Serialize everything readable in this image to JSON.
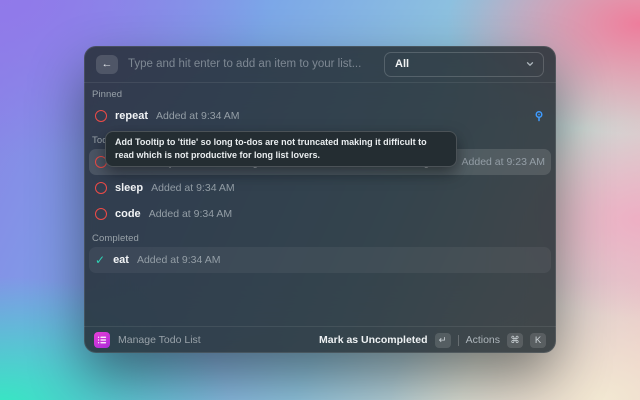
{
  "header": {
    "back_glyph": "←",
    "input_placeholder": "Type and hit enter to add an item to your list...",
    "filter_value": "All"
  },
  "sections": [
    {
      "label": "Pinned",
      "items": [
        {
          "id": "repeat",
          "title": "repeat",
          "meta": "Added at 9:34 AM",
          "state": "open",
          "pinned": true
        }
      ]
    },
    {
      "label": "Todo",
      "items": [
        {
          "id": "long-todo",
          "title": "Add Tooltip to 'title' so long to-dos are not truncated making it difficult to read which is...",
          "meta": "Added at 9:23 AM",
          "state": "open",
          "selected": true
        },
        {
          "id": "sleep",
          "title": "sleep",
          "meta": "Added at 9:34 AM",
          "state": "open"
        },
        {
          "id": "code",
          "title": "code",
          "meta": "Added at 9:34 AM",
          "state": "open"
        }
      ]
    },
    {
      "label": "Completed",
      "items": [
        {
          "id": "eat",
          "title": "eat",
          "meta": "Added at 9:34 AM",
          "state": "done",
          "subtle": true
        }
      ]
    }
  ],
  "tooltip": {
    "text": "Add Tooltip to 'title' so long to-dos are not truncated making it difficult to read which is not productive for long list lovers."
  },
  "footer": {
    "app_name": "Manage Todo List",
    "primary_action": "Mark as Uncompleted",
    "primary_key": "↵",
    "actions_label": "Actions",
    "actions_keys": [
      "⌘",
      "K"
    ]
  },
  "colors": {
    "accent_red": "#ee4b47",
    "accent_teal": "#2fd3b5",
    "pin_blue": "#3e9bff",
    "brand_magenta": "#e93fd7",
    "panel_bg": "rgba(37,45,51,0.85)"
  }
}
